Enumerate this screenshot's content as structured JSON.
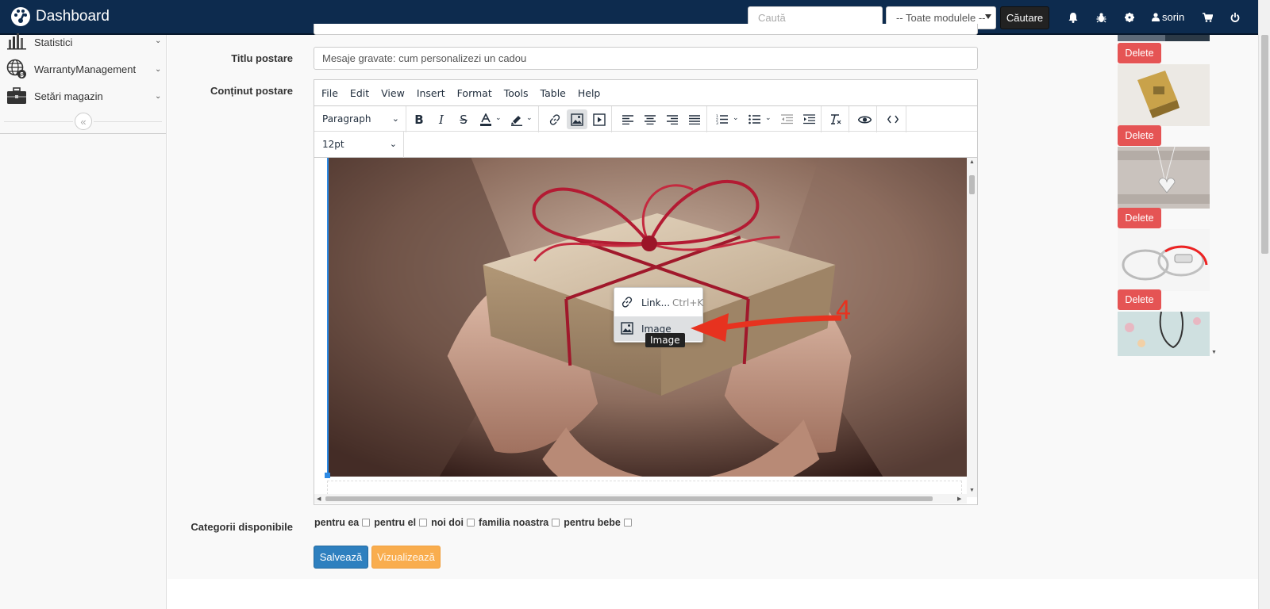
{
  "navbar": {
    "brand": "Dashboard",
    "search_placeholder": "Caută",
    "module_select": "-- Toate modulele --",
    "search_button": "Căutare",
    "username": "sorin",
    "icons": [
      "bell-icon",
      "bug-icon",
      "gear-icon",
      "user-icon",
      "cart-icon",
      "power-icon"
    ]
  },
  "sidebar": {
    "items": [
      {
        "label": "Statistici",
        "icon": "bar-chart-icon"
      },
      {
        "label": "WarrantyManagement",
        "icon": "globe-dollar-icon"
      },
      {
        "label": "Setări magazin",
        "icon": "briefcase-icon"
      }
    ],
    "collapse_icon": "«"
  },
  "form": {
    "title_label": "Titlu postare",
    "title_value": "Mesaje gravate: cum personalizezi un cadou",
    "content_label": "Conținut postare",
    "categories_label": "Categorii disponibile",
    "categories": [
      "pentru ea",
      "pentru el",
      "noi doi",
      "familia noastra",
      "pentru bebe"
    ],
    "save_button": "Salvează",
    "preview_button": "Vizualizează"
  },
  "editor": {
    "menu": [
      "File",
      "Edit",
      "View",
      "Insert",
      "Format",
      "Tools",
      "Table",
      "Help"
    ],
    "block_format": "Paragraph",
    "font_size": "12pt",
    "context_menu": [
      {
        "label": "Link...",
        "shortcut": "Ctrl+K",
        "icon": "link-icon"
      },
      {
        "label": "Image",
        "shortcut": "",
        "icon": "image-icon"
      }
    ],
    "tooltip": "Image",
    "annotation_number": "4"
  },
  "gallery": {
    "delete_label": "Delete",
    "items": [
      "gift-box",
      "gold-lighter",
      "heart-necklace",
      "red-bracelet",
      "cord-necklace"
    ]
  },
  "colors": {
    "navbar": "#0d2b4e",
    "accent_blue": "#2e80bf",
    "warning_orange": "#f9ad4e",
    "danger_red": "#e55454",
    "annotation_red": "#e7321f"
  }
}
